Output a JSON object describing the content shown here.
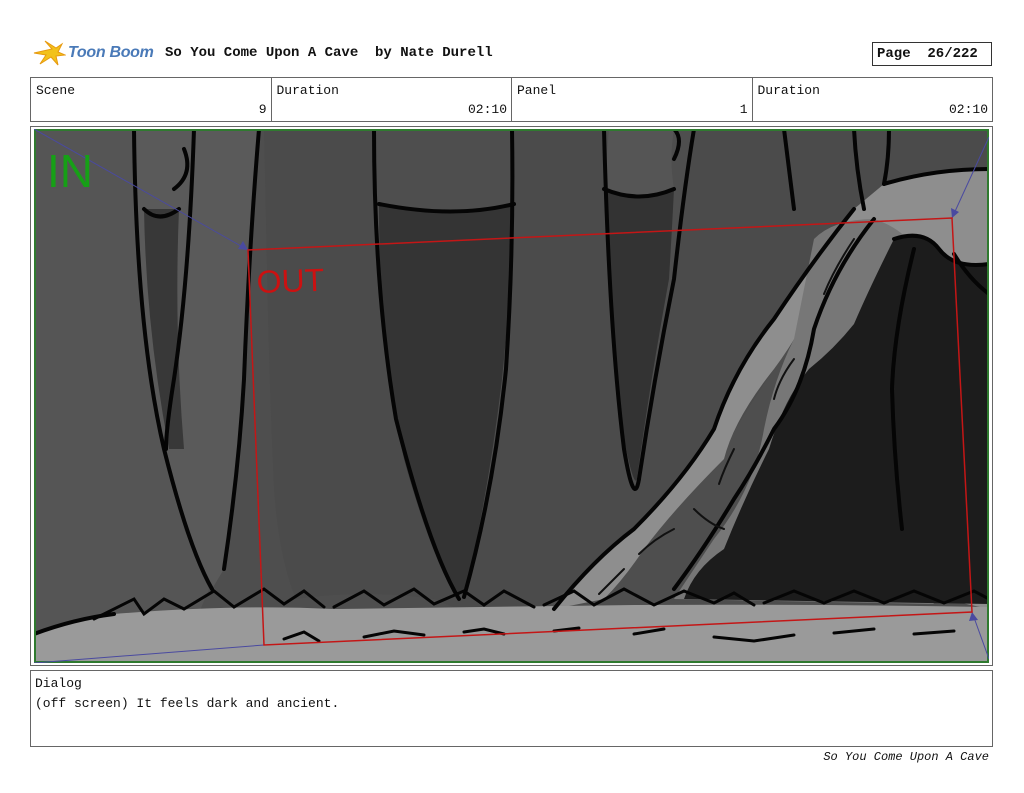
{
  "header": {
    "logo_text": "Toon Boom",
    "title": "So You Come Upon A Cave  by Nate Durell",
    "page_label": "Page  26/222"
  },
  "info": {
    "scene_label": "Scene",
    "scene_value": "9",
    "duration_label": "Duration",
    "duration_value": "02:10",
    "panel_label": "Panel",
    "panel_value": "1",
    "panel_duration_label": "Duration",
    "panel_duration_value": "02:10"
  },
  "panel": {
    "in_label": "IN",
    "out_label": "OUT",
    "in_color": "#16a016",
    "out_color": "#cc1111"
  },
  "dialog": {
    "label": "Dialog",
    "text": "(off screen) It feels dark and ancient."
  },
  "footer": {
    "text": "So You Come Upon A Cave"
  }
}
